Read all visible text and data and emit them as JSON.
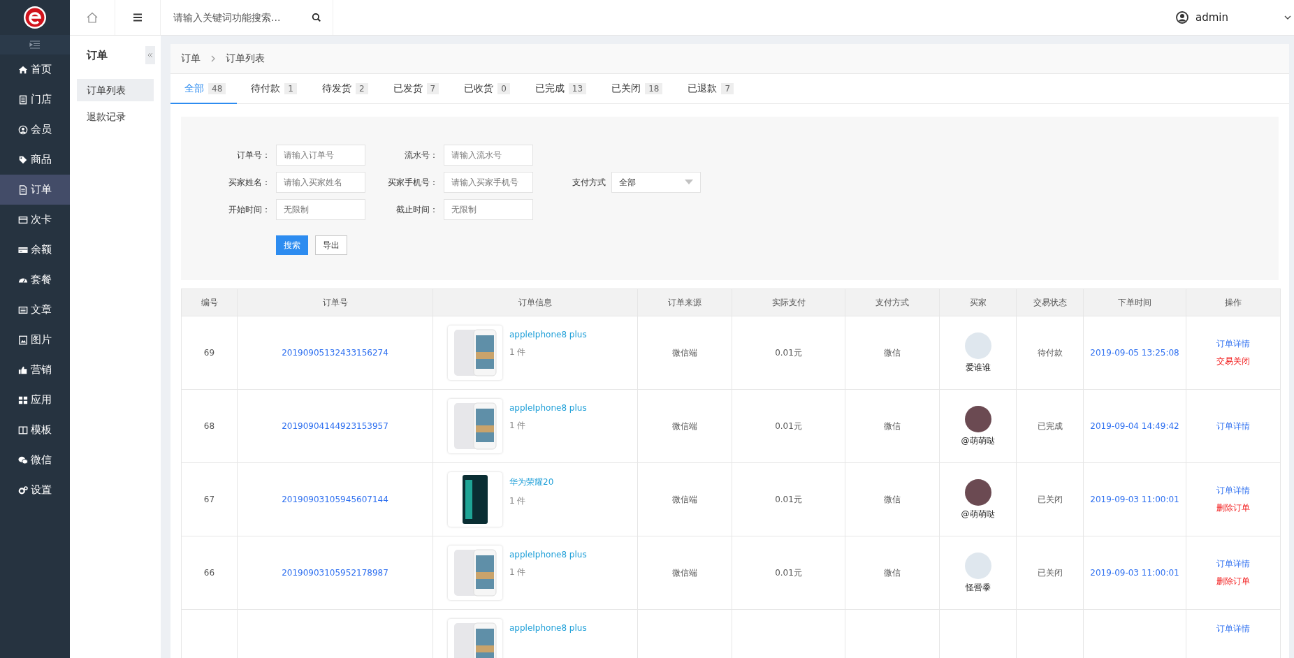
{
  "nav": {
    "items": [
      {
        "label": "首页",
        "selected": false
      },
      {
        "label": "门店",
        "selected": false
      },
      {
        "label": "会员",
        "selected": false
      },
      {
        "label": "商品",
        "selected": false
      },
      {
        "label": "订单",
        "selected": true
      },
      {
        "label": "次卡",
        "selected": false
      },
      {
        "label": "余额",
        "selected": false
      },
      {
        "label": "套餐",
        "selected": false
      },
      {
        "label": "文章",
        "selected": false
      },
      {
        "label": "图片",
        "selected": false
      },
      {
        "label": "营销",
        "selected": false
      },
      {
        "label": "应用",
        "selected": false
      },
      {
        "label": "模板",
        "selected": false
      },
      {
        "label": "微信",
        "selected": false
      },
      {
        "label": "设置",
        "selected": false
      }
    ]
  },
  "subnav": {
    "title": "订单",
    "items": [
      {
        "label": "订单列表",
        "selected": true
      },
      {
        "label": "退款记录",
        "selected": false
      }
    ]
  },
  "topbar": {
    "search_placeholder": "请输入关键词功能搜索...",
    "user": "admin"
  },
  "breadcrumb": [
    "订单",
    "订单列表"
  ],
  "tabs": [
    {
      "label": "全部",
      "count": "48",
      "selected": true
    },
    {
      "label": "待付款",
      "count": "1",
      "selected": false
    },
    {
      "label": "待发货",
      "count": "2",
      "selected": false
    },
    {
      "label": "已发货",
      "count": "7",
      "selected": false
    },
    {
      "label": "已收货",
      "count": "0",
      "selected": false
    },
    {
      "label": "已完成",
      "count": "13",
      "selected": false
    },
    {
      "label": "已关闭",
      "count": "18",
      "selected": false
    },
    {
      "label": "已退款",
      "count": "7",
      "selected": false
    }
  ],
  "filters": {
    "rows": [
      [
        {
          "kind": "input",
          "label": "订单号：",
          "placeholder": "请输入订单号"
        },
        {
          "kind": "input",
          "label": "流水号：",
          "placeholder": "请输入流水号"
        }
      ],
      [
        {
          "kind": "input",
          "label": "买家姓名：",
          "placeholder": "请输入买家姓名"
        },
        {
          "kind": "input",
          "label": "买家手机号：",
          "placeholder": "请输入买家手机号"
        },
        {
          "kind": "select",
          "label": "支付方式",
          "value": "全部"
        }
      ],
      [
        {
          "kind": "input",
          "label": "开始时间：",
          "placeholder": "无限制"
        },
        {
          "kind": "input",
          "label": "截止时间：",
          "placeholder": "无限制"
        }
      ]
    ],
    "buttons": [
      {
        "label": "搜索",
        "kind": "primary"
      },
      {
        "label": "导出",
        "kind": "default"
      }
    ]
  },
  "table": {
    "columns": [
      "编号",
      "订单号",
      "订单信息",
      "订单来源",
      "实际支付",
      "支付方式",
      "买家",
      "交易状态",
      "下单时间",
      "操作"
    ],
    "rows": [
      {
        "id": "69",
        "order_no": "20190905132433156274",
        "product": {
          "name": "appleIphone8 plus",
          "qty": "1 件",
          "kind": "silver"
        },
        "source": "微信端",
        "paid": "0.01元",
        "pay_method": "微信",
        "buyer": {
          "name": "爱谁谁",
          "kind": "placeholder"
        },
        "status": "待付款",
        "time": "2019-09-05 13:25:08",
        "actions": [
          {
            "label": "订单详情",
            "kind": "link"
          },
          {
            "label": "交易关闭",
            "kind": "danger"
          }
        ]
      },
      {
        "id": "68",
        "order_no": "20190904144923153957",
        "product": {
          "name": "appleIphone8 plus",
          "qty": "1 件",
          "kind": "silver"
        },
        "source": "微信端",
        "paid": "0.01元",
        "pay_method": "微信",
        "buyer": {
          "name": "@萌萌哒",
          "kind": "photo"
        },
        "status": "已完成",
        "time": "2019-09-04 14:49:42",
        "actions": [
          {
            "label": "订单详情",
            "kind": "link"
          }
        ]
      },
      {
        "id": "67",
        "order_no": "20190903105945607144",
        "product": {
          "name": "华为荣耀20",
          "qty": "1 件",
          "kind": "green"
        },
        "source": "微信端",
        "paid": "0.01元",
        "pay_method": "微信",
        "buyer": {
          "name": "@萌萌哒",
          "kind": "photo"
        },
        "status": "已关闭",
        "time": "2019-09-03 11:00:01",
        "actions": [
          {
            "label": "订单详情",
            "kind": "link"
          },
          {
            "label": "删除订单",
            "kind": "danger"
          }
        ]
      },
      {
        "id": "66",
        "order_no": "20190903105952178987",
        "product": {
          "name": "appleIphone8 plus",
          "qty": "1 件",
          "kind": "silver"
        },
        "source": "微信端",
        "paid": "0.01元",
        "pay_method": "微信",
        "buyer": {
          "name": "怪罾黍",
          "kind": "placeholder"
        },
        "status": "已关闭",
        "time": "2019-09-03 11:00:01",
        "actions": [
          {
            "label": "订单详情",
            "kind": "link"
          },
          {
            "label": "删除订单",
            "kind": "danger"
          }
        ]
      },
      {
        "product": {
          "name": "appleIphone8 plus",
          "kind": "silver"
        },
        "actions": [
          {
            "label": "订单详情",
            "kind": "link"
          }
        ]
      }
    ]
  }
}
